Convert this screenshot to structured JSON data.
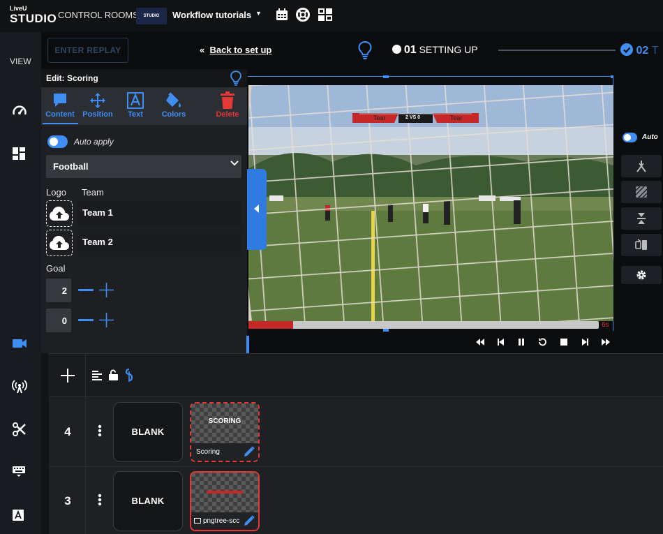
{
  "logo": {
    "line1": "LiveU",
    "line2": "STUDIO"
  },
  "header": {
    "control_rooms": "CONTROL ROOMS",
    "workspace_thumb": "STUDIO",
    "workspace_name": "Workflow tutorials",
    "icons": [
      "calendar-icon",
      "help-lifebuoy-icon",
      "layout-grid-icon"
    ]
  },
  "toolbar": {
    "enter_replay": "ENTER REPLAY",
    "back_arrows": "«",
    "back_to_setup": "Back to set up",
    "step1_num": "01",
    "step1_label": "SETTING UP",
    "step2_num": "02",
    "step2_label": "T"
  },
  "sidebar": {
    "view_label": "VIEW",
    "items": [
      "speedometer-icon",
      "dashboard-icon",
      "camera-icon",
      "antenna-icon",
      "scissors-icon",
      "keyboard-icon",
      "text-icon"
    ]
  },
  "edit": {
    "title": "Edit: Scoring",
    "tabs": [
      {
        "label": "Content",
        "icon": "speech-bubble-icon"
      },
      {
        "label": "Position",
        "icon": "move-arrows-icon"
      },
      {
        "label": "Text",
        "icon": "text-a-icon"
      },
      {
        "label": "Colors",
        "icon": "paint-bucket-icon"
      },
      {
        "label": "Delete",
        "icon": "trash-icon"
      }
    ],
    "auto_apply": "Auto apply",
    "sport": "Football",
    "logo_label": "Logo",
    "team_label": "Team",
    "teams": [
      "Team 1",
      "Team 2"
    ],
    "goal_label": "Goal",
    "goals": [
      "2",
      "0"
    ]
  },
  "preview": {
    "score_left": "Tear",
    "score_center": "2 VS 0",
    "score_right": "Tear",
    "progress_fraction": 0.127,
    "time": "6s",
    "accent": "#3f8ef4",
    "progress_color": "#c62828"
  },
  "right_panel": {
    "auto": "Auto",
    "buttons": [
      "merge-icon",
      "pattern-icon",
      "collapse-vertical-icon",
      "swap-icon",
      "gear-icon"
    ]
  },
  "timeline": {
    "rows": [
      {
        "num": "4",
        "blank": "BLANK",
        "card_title": "SCORING",
        "card_label": "Scoring"
      },
      {
        "num": "3",
        "blank": "BLANK",
        "card_title": "",
        "card_label": "pngtree-scc"
      }
    ]
  }
}
